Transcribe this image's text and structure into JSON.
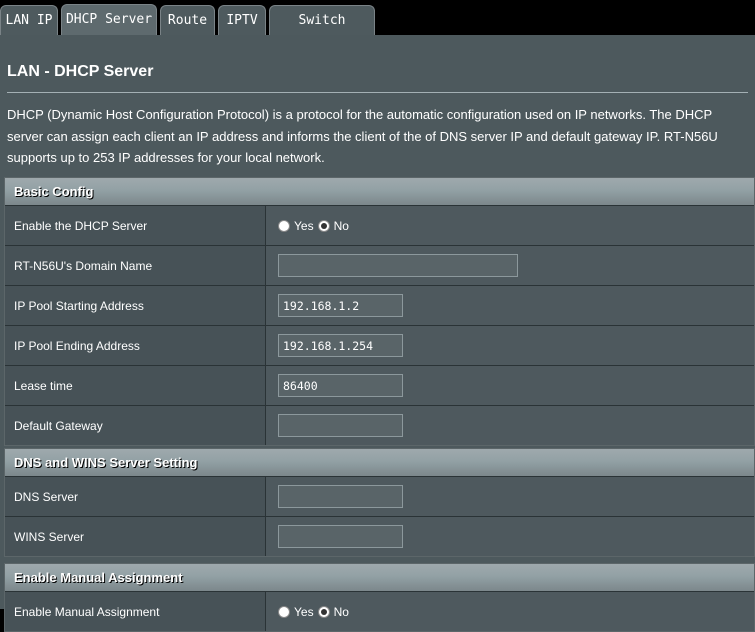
{
  "tabs": [
    {
      "label": "LAN IP",
      "active": false
    },
    {
      "label": "DHCP Server",
      "active": true
    },
    {
      "label": "Route",
      "active": false
    },
    {
      "label": "IPTV",
      "active": false
    },
    {
      "label": "Switch Control",
      "active": false
    }
  ],
  "page": {
    "title": "LAN - DHCP Server",
    "description": "DHCP (Dynamic Host Configuration Protocol) is a protocol for the automatic configuration used on IP networks. The DHCP server can assign each client an IP address and informs the client of the of DNS server IP and default gateway IP. RT-N56U supports up to 253 IP addresses for your local network."
  },
  "basic": {
    "header": "Basic Config",
    "enable_dhcp": {
      "label": "Enable the DHCP Server",
      "yes": "Yes",
      "no": "No",
      "selected": "No"
    },
    "domain_name": {
      "label": "RT-N56U's Domain Name",
      "value": ""
    },
    "pool_start": {
      "label": "IP Pool Starting Address",
      "value": "192.168.1.2"
    },
    "pool_end": {
      "label": "IP Pool Ending Address",
      "value": "192.168.1.254"
    },
    "lease_time": {
      "label": "Lease time",
      "value": "86400"
    },
    "gateway": {
      "label": "Default Gateway",
      "value": ""
    }
  },
  "dns": {
    "header": "DNS and WINS Server Setting",
    "dns_server": {
      "label": "DNS Server",
      "value": ""
    },
    "wins_server": {
      "label": "WINS Server",
      "value": ""
    }
  },
  "manual": {
    "header": "Enable Manual Assignment",
    "enable_manual": {
      "label": "Enable Manual Assignment",
      "yes": "Yes",
      "no": "No",
      "selected": "No"
    }
  },
  "colors": {
    "background": "#4d595d",
    "header_bar": "#92a1a5",
    "label_cell": "#475257",
    "value_cell": "#4e595e"
  }
}
